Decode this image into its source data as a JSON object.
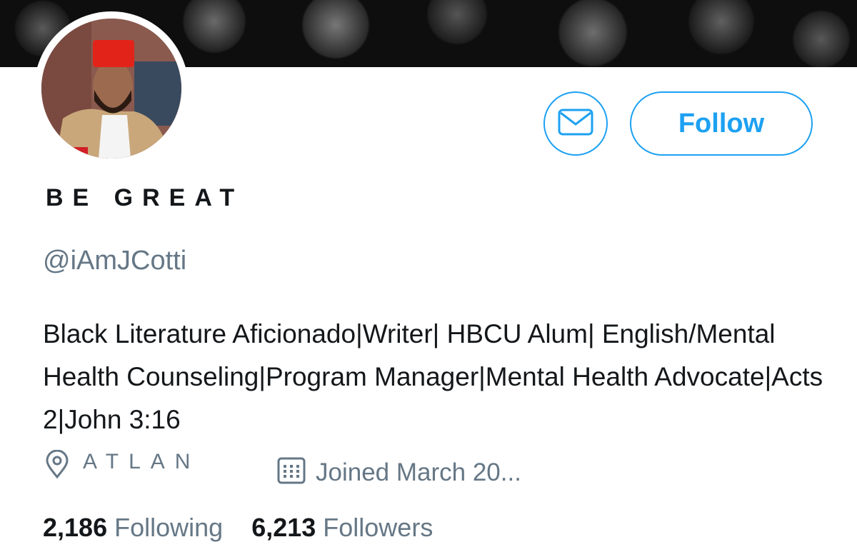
{
  "profile": {
    "display_name": "BE GREAT",
    "handle": "@iAmJCotti",
    "bio": "Black Literature Aficionado|Writer| HBCU Alum| English/Mental Health Counseling|Program Manager|Mental Health Advocate|Acts 2|John 3:16",
    "location": "ATLANTA",
    "joined": "Joined March 20...",
    "following_count": "2,186",
    "following_label": "Following",
    "followers_count": "6,213",
    "followers_label": "Followers"
  },
  "actions": {
    "follow_label": "Follow"
  },
  "icons": {
    "message": "envelope-icon",
    "location": "location-pin-icon",
    "calendar": "calendar-icon"
  },
  "colors": {
    "accent": "#1da1f2",
    "text_primary": "#14171a",
    "text_secondary": "#657786"
  }
}
